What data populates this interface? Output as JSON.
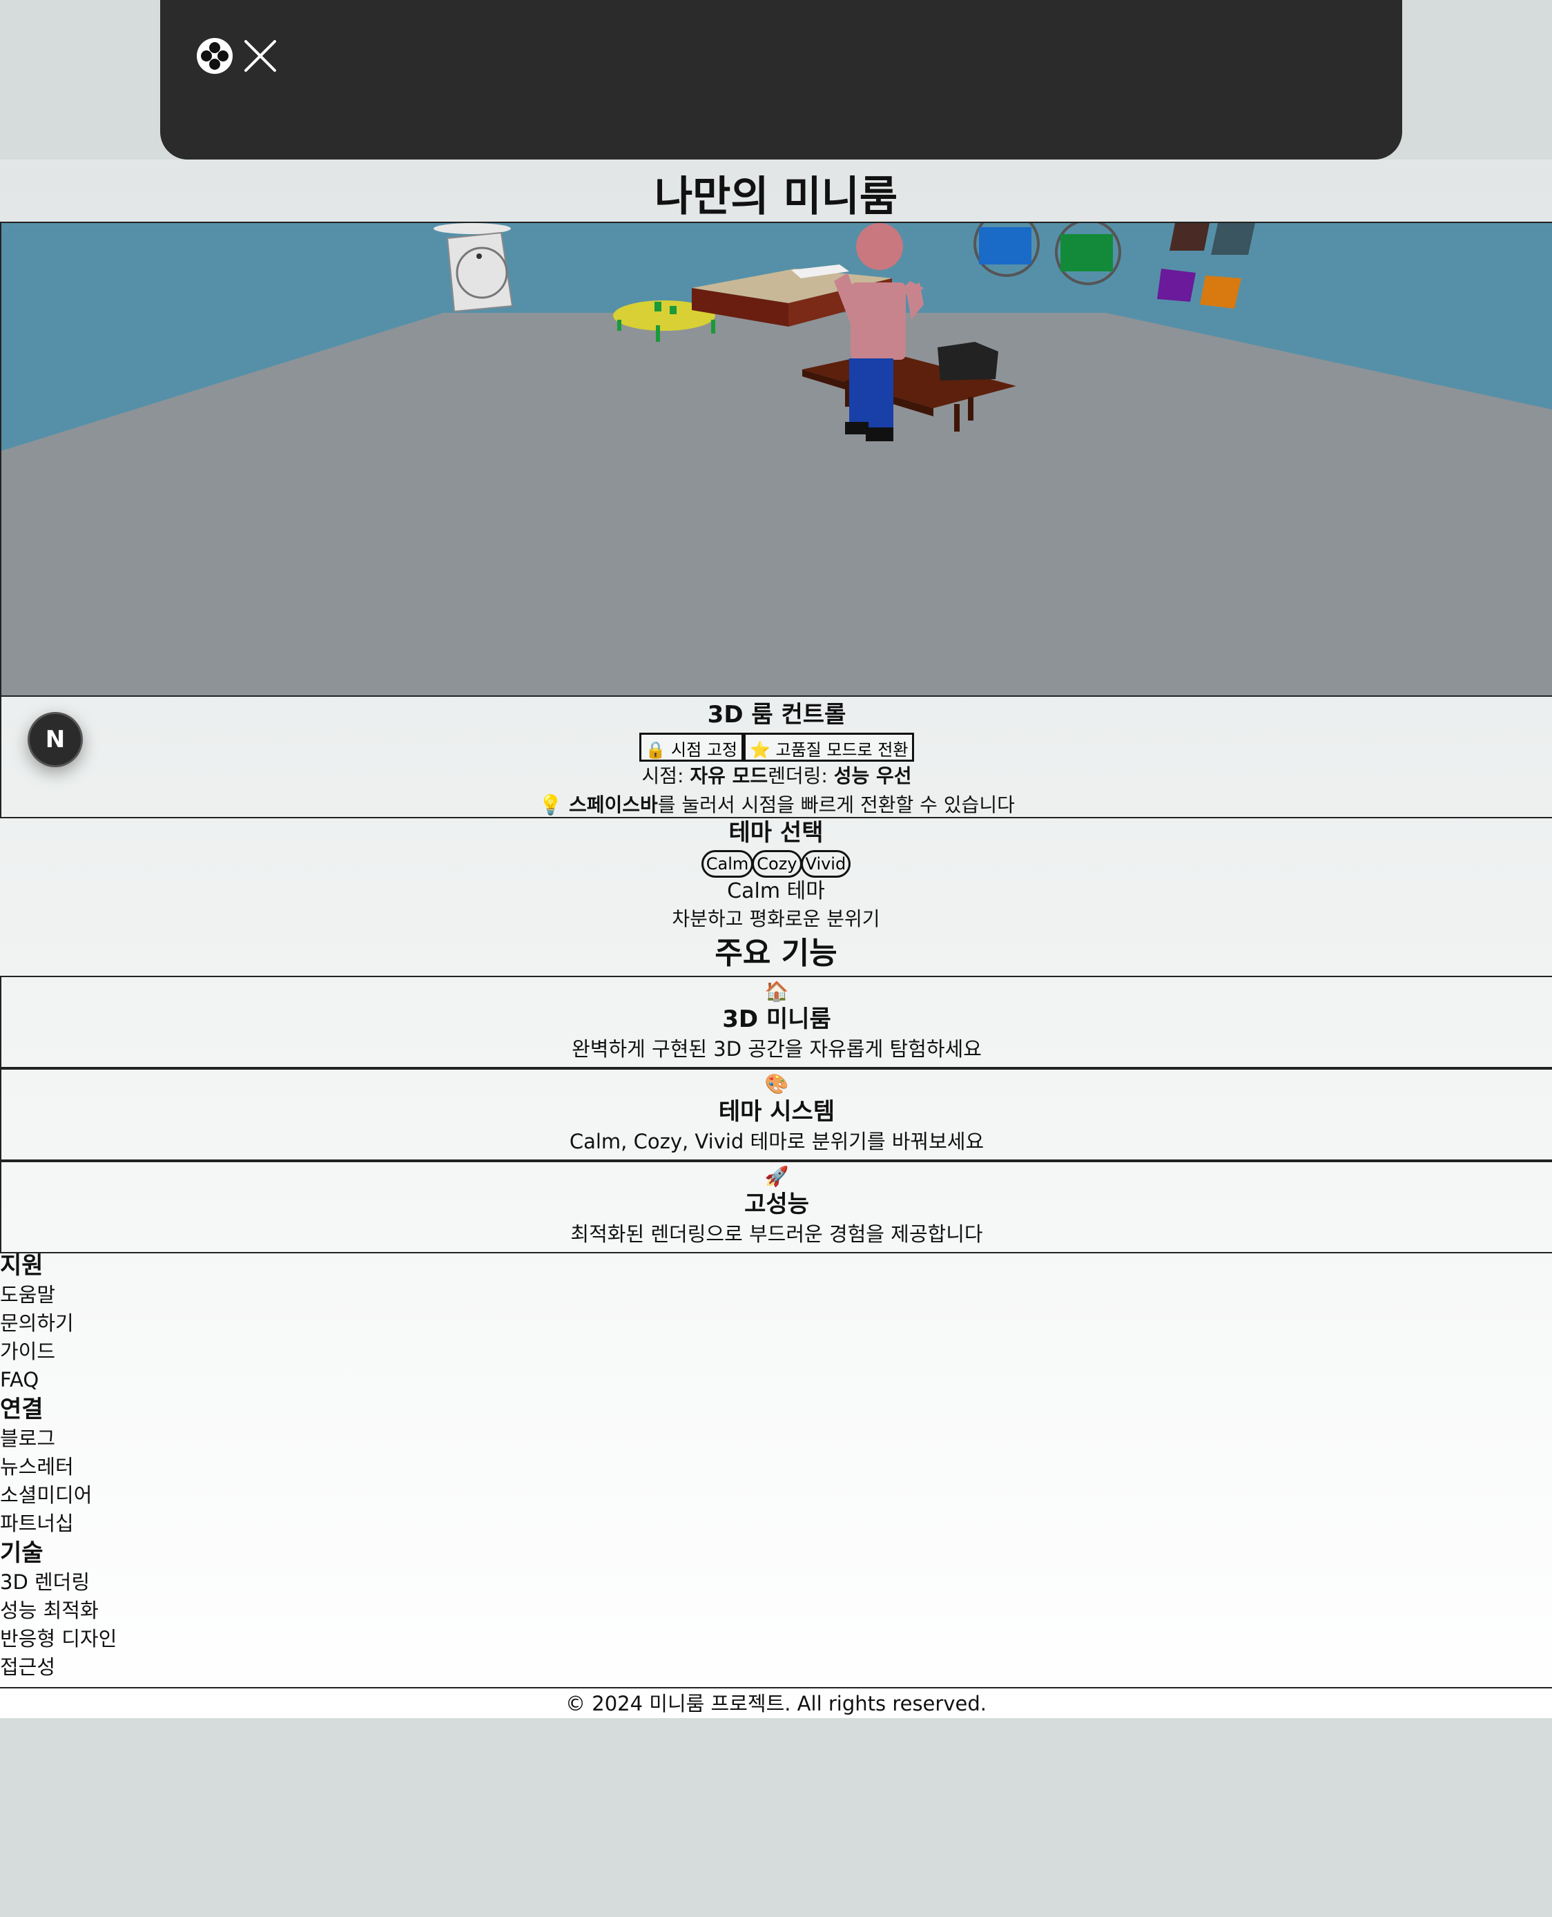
{
  "header": {
    "logo_icon": "quatrefoil-logo-icon",
    "close_icon": "close-x-icon"
  },
  "page": {
    "title": "나만의 미니룸"
  },
  "controls": {
    "badge": "N",
    "title": "3D 룸 컨트롤",
    "lock_button": "🔒 시점 고정",
    "quality_button": "⭐ 고품질 모드로 전환",
    "status_view_label": "시점: ",
    "status_view_value": "자유 모드",
    "status_render_label": "렌더링: ",
    "status_render_value": "성능 우선",
    "tip_icon": "💡",
    "tip_key": "스페이스바",
    "tip_text": "를 눌러서 시점을 빠르게 전환할 수 있습니다"
  },
  "theme": {
    "title": "테마 선택",
    "options": [
      "Calm",
      "Cozy",
      "Vivid"
    ],
    "current_name": "Calm 테마",
    "current_desc": "차분하고 평화로운 분위기"
  },
  "features": {
    "title": "주요 기능",
    "cards": [
      {
        "icon": "🏠",
        "title": "3D 미니룸",
        "desc": "완벽하게 구현된 3D 공간을 자유롭게 탐험하세요"
      },
      {
        "icon": "🎨",
        "title": "테마 시스템",
        "desc": "Calm, Cozy, Vivid 테마로 분위기를 바꿔보세요"
      },
      {
        "icon": "🚀",
        "title": "고성능",
        "desc": "최적화된 렌더링으로 부드러운 경험을 제공합니다"
      }
    ]
  },
  "footer": {
    "sections": [
      {
        "heading": "지원",
        "links": [
          "도움말",
          "문의하기",
          "가이드",
          "FAQ"
        ]
      },
      {
        "heading": "연결",
        "links": [
          "블로그",
          "뉴스레터",
          "소셜미디어",
          "파트너십"
        ]
      },
      {
        "heading": "기술",
        "links": [
          "3D 렌더링",
          "성능 최적화",
          "반응형 디자인",
          "접근성"
        ]
      }
    ],
    "copyright": "© 2024 미니룸 프로젝트. All rights reserved."
  },
  "colors": {
    "wall": "#5690a8",
    "floor": "#8e9397",
    "topbar": "#2b2b2b"
  }
}
